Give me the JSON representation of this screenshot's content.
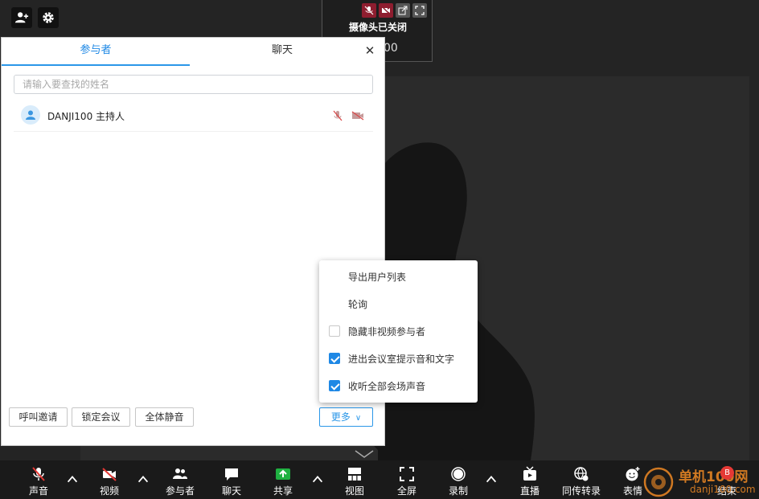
{
  "thumbnail": {
    "camera_off_text": "摄像头已关闭",
    "name_tail": "00"
  },
  "panel": {
    "tabs": [
      {
        "label": "参与者"
      },
      {
        "label": "聊天"
      }
    ],
    "search_placeholder": "请输入要查找的姓名",
    "participants": [
      {
        "name": "DANJI100 主持人"
      }
    ],
    "buttons": {
      "call_invite": "呼叫邀请",
      "lock_meeting": "锁定会议",
      "mute_all": "全体静音",
      "more": "更多"
    }
  },
  "more_menu": {
    "items": [
      {
        "label": "导出用户列表",
        "checkbox": false
      },
      {
        "label": "轮询",
        "checkbox": false
      },
      {
        "label": "隐藏非视频参与者",
        "checkbox": true,
        "checked": false
      },
      {
        "label": "进出会议室提示音和文字",
        "checkbox": true,
        "checked": true
      },
      {
        "label": "收听全部会场声音",
        "checkbox": true,
        "checked": true
      }
    ]
  },
  "toolbar": {
    "items": [
      {
        "label": "声音",
        "icon": "mic-muted-icon"
      },
      {
        "label": "视频",
        "icon": "camera-off-icon"
      },
      {
        "label": "参与者",
        "icon": "participants-icon"
      },
      {
        "label": "聊天",
        "icon": "chat-icon"
      },
      {
        "label": "共享",
        "icon": "share-icon"
      },
      {
        "label": "视图",
        "icon": "layout-icon"
      },
      {
        "label": "全屏",
        "icon": "fullscreen-icon"
      },
      {
        "label": "录制",
        "icon": "record-icon"
      },
      {
        "label": "直播",
        "icon": "live-icon"
      },
      {
        "label": "同传转录",
        "icon": "transcribe-icon"
      },
      {
        "label": "表情",
        "icon": "emoji-icon"
      },
      {
        "label": "结束",
        "icon": "end-icon"
      }
    ]
  },
  "watermark": {
    "title": "单机100网",
    "url": "danji100.com",
    "badge": "B"
  },
  "colors": {
    "accent": "#2b97e8",
    "muted_red": "#8e1d2f",
    "toolbar_bg": "#1a1a1a",
    "share_green": "#1fb141"
  }
}
